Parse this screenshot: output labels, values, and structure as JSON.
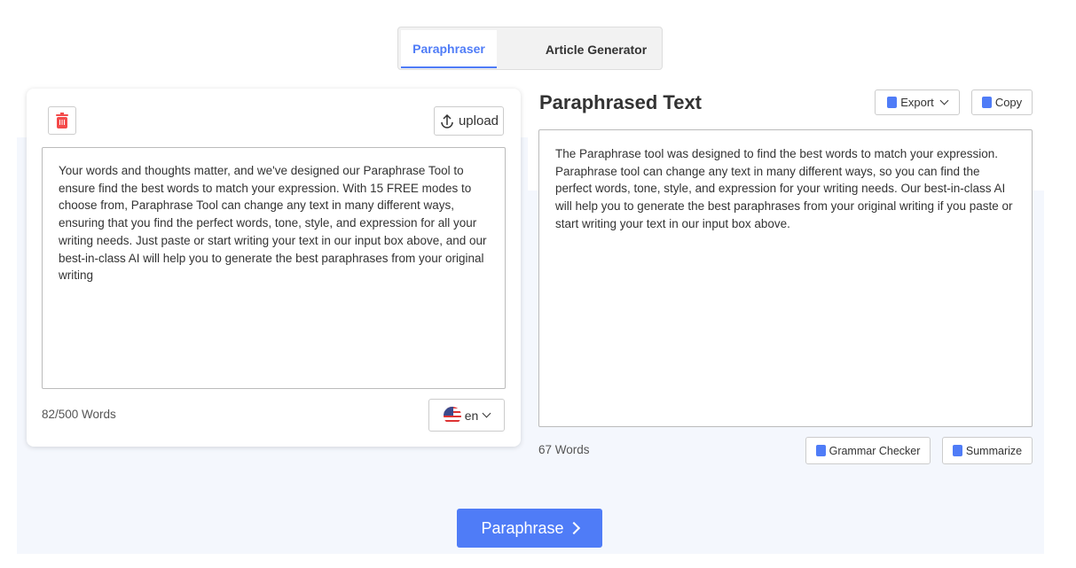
{
  "tabs": [
    {
      "label": "Paraphraser",
      "active": true
    },
    {
      "label": "Article Generator",
      "active": false
    }
  ],
  "input": {
    "upload_label": "upload",
    "text": "Your words and thoughts matter, and we've designed our Paraphrase Tool to ensure find the best words to match your expression. With 15 FREE modes to choose from, Paraphrase Tool can change any text in many different ways, ensuring that you find the perfect words, tone, style, and expression for all your writing needs. Just paste or start writing your text in our input box above, and our best-in-class AI will help you to generate the best paraphrases from your original writing",
    "word_count": "82/500 Words",
    "language": "en"
  },
  "output": {
    "title": "Paraphrased Text",
    "export_label": "Export",
    "copy_label": "Copy",
    "text": "The Paraphrase tool was designed to find the best words to match your expression. Paraphrase tool can change any text in many different ways, so you can find the perfect words, tone, style, and expression for your writing needs. Our best-in-class AI will help you to generate the best paraphrases from your original writing if you paste or start writing your text in our input box above.",
    "word_count": "67 Words",
    "grammar_label": "Grammar Checker",
    "summarize_label": "Summarize"
  },
  "paraphrase_button": "Paraphrase",
  "colors": {
    "accent": "#4f7cf7",
    "delete": "#f44a4a",
    "panel_bg": "#f4f7fd"
  }
}
